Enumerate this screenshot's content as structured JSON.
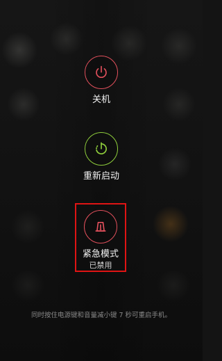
{
  "menu": {
    "power_off": {
      "label": "关机",
      "icon": "power-icon",
      "color": "#e2505c"
    },
    "restart": {
      "label": "重新启动",
      "icon": "restart-icon",
      "color": "#8fce3c"
    },
    "emergency": {
      "label": "紧急模式",
      "status": "已禁用",
      "icon": "emergency-light-icon",
      "color": "#e2505c",
      "highlight_color": "#e01414"
    }
  },
  "hint": "同时按住电源键和音量减小键 7 秒可重启手机。"
}
